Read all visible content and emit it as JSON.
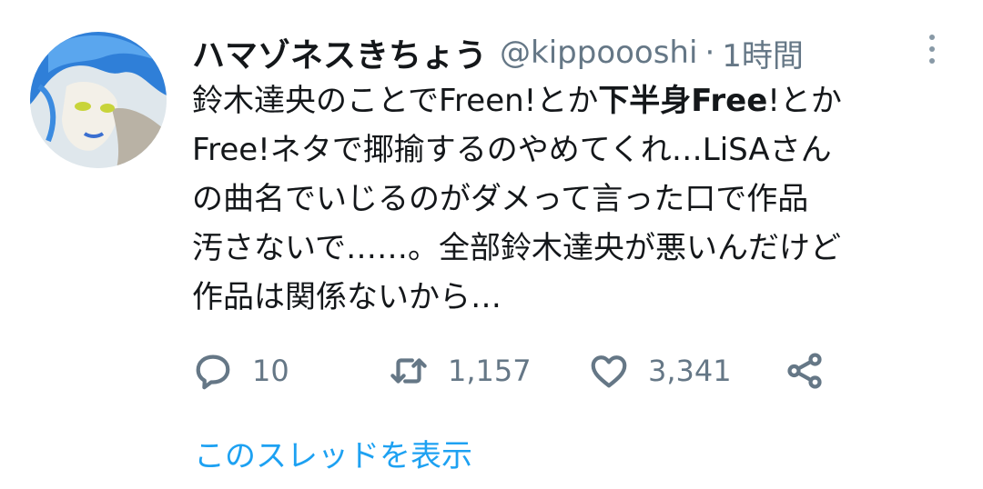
{
  "tweet": {
    "display_name": "ハマゾネスきちょう",
    "handle": "@kippoooshi",
    "separator": "·",
    "time": "1時間",
    "text_lines": [
      [
        "鈴木達央のことでFreen!とか",
        "下半身Free",
        "!とか"
      ],
      "Free!ネタで揶揄するのやめてくれ…LiSAさん",
      "の曲名でいじるのがダメって言った口で作品",
      "汚さないで……。全部鈴木達央が悪いんだけど",
      "作品は関係ないから…"
    ]
  },
  "actions": {
    "reply_count": "10",
    "retweet_count": "1,157",
    "like_count": "3,341"
  },
  "show_thread_label": "このスレッドを表示",
  "icons": {
    "more": "more-vertical-icon",
    "reply": "reply-icon",
    "retweet": "retweet-icon",
    "like": "heart-icon",
    "share": "share-icon"
  },
  "colors": {
    "link": "#1da1f2",
    "secondary": "#657786",
    "text": "#14171a"
  }
}
